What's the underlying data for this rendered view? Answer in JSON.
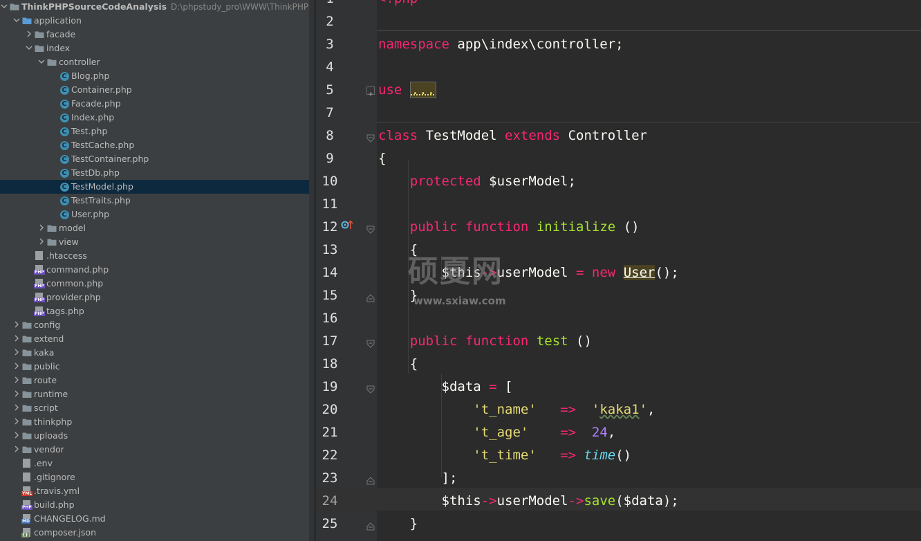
{
  "project": {
    "name": "ThinkPHPSourceCodeAnalysis",
    "path": "D:\\phpstudy_pro\\WWW\\ThinkPHPSource"
  },
  "tree": [
    {
      "label": "ThinkPHPSourceCodeAnalysis",
      "type": "root",
      "depth": 0,
      "arrow": "down"
    },
    {
      "label": "application",
      "type": "folder",
      "depth": 1,
      "arrow": "down"
    },
    {
      "label": "facade",
      "type": "folder",
      "depth": 2,
      "arrow": "right"
    },
    {
      "label": "index",
      "type": "folder",
      "depth": 2,
      "arrow": "down"
    },
    {
      "label": "controller",
      "type": "folder",
      "depth": 3,
      "arrow": "down"
    },
    {
      "label": "Blog.php",
      "type": "class",
      "depth": 4
    },
    {
      "label": "Container.php",
      "type": "class",
      "depth": 4
    },
    {
      "label": "Facade.php",
      "type": "class",
      "depth": 4
    },
    {
      "label": "Index.php",
      "type": "class",
      "depth": 4
    },
    {
      "label": "Test.php",
      "type": "class",
      "depth": 4
    },
    {
      "label": "TestCache.php",
      "type": "class",
      "depth": 4
    },
    {
      "label": "TestContainer.php",
      "type": "class",
      "depth": 4
    },
    {
      "label": "TestDb.php",
      "type": "class",
      "depth": 4
    },
    {
      "label": "TestModel.php",
      "type": "class",
      "depth": 4,
      "selected": true
    },
    {
      "label": "TestTraits.php",
      "type": "class",
      "depth": 4
    },
    {
      "label": "User.php",
      "type": "class",
      "depth": 4
    },
    {
      "label": "model",
      "type": "folder",
      "depth": 3,
      "arrow": "right"
    },
    {
      "label": "view",
      "type": "folder",
      "depth": 3,
      "arrow": "right"
    },
    {
      "label": ".htaccess",
      "type": "htaccess",
      "depth": 2
    },
    {
      "label": "command.php",
      "type": "php",
      "depth": 2
    },
    {
      "label": "common.php",
      "type": "php",
      "depth": 2
    },
    {
      "label": "provider.php",
      "type": "php",
      "depth": 2
    },
    {
      "label": "tags.php",
      "type": "php",
      "depth": 2
    },
    {
      "label": "config",
      "type": "folder",
      "depth": 1,
      "arrow": "right"
    },
    {
      "label": "extend",
      "type": "folder",
      "depth": 1,
      "arrow": "right"
    },
    {
      "label": "kaka",
      "type": "folder",
      "depth": 1,
      "arrow": "right"
    },
    {
      "label": "public",
      "type": "folder",
      "depth": 1,
      "arrow": "right"
    },
    {
      "label": "route",
      "type": "folder",
      "depth": 1,
      "arrow": "right"
    },
    {
      "label": "runtime",
      "type": "folder",
      "depth": 1,
      "arrow": "right"
    },
    {
      "label": "script",
      "type": "folder",
      "depth": 1,
      "arrow": "right"
    },
    {
      "label": "thinkphp",
      "type": "folder",
      "depth": 1,
      "arrow": "right"
    },
    {
      "label": "uploads",
      "type": "folder",
      "depth": 1,
      "arrow": "right"
    },
    {
      "label": "vendor",
      "type": "folder",
      "depth": 1,
      "arrow": "right"
    },
    {
      "label": ".env",
      "type": "text",
      "depth": 1
    },
    {
      "label": ".gitignore",
      "type": "gitignore",
      "depth": 1
    },
    {
      "label": ".travis.yml",
      "type": "yml",
      "depth": 1
    },
    {
      "label": "build.php",
      "type": "php",
      "depth": 1
    },
    {
      "label": "CHANGELOG.md",
      "type": "md",
      "depth": 1
    },
    {
      "label": "composer.json",
      "type": "json",
      "depth": 1
    }
  ],
  "editor": {
    "current_line": 24,
    "lines": [
      {
        "n": 1,
        "tokens": [
          {
            "t": "<?php",
            "c": "k"
          }
        ]
      },
      {
        "n": 2,
        "tokens": []
      },
      {
        "n": 3,
        "tokens": [
          {
            "t": "namespace",
            "c": "k"
          },
          {
            "t": " app\\index\\controller;"
          }
        ]
      },
      {
        "n": 4,
        "tokens": []
      },
      {
        "n": 5,
        "tokens": [
          {
            "t": "use",
            "c": "k"
          },
          {
            "t": " "
          },
          {
            "t": "...",
            "c": "folded"
          }
        ]
      },
      {
        "n": 7,
        "tokens": []
      },
      {
        "n": 8,
        "tokens": [
          {
            "t": "class",
            "c": "k"
          },
          {
            "t": " TestModel "
          },
          {
            "t": "extends",
            "c": "k"
          },
          {
            "t": " Controller"
          }
        ]
      },
      {
        "n": 9,
        "tokens": [
          {
            "t": "{"
          }
        ]
      },
      {
        "n": 10,
        "tokens": [
          {
            "t": "    "
          },
          {
            "t": "protected",
            "c": "k"
          },
          {
            "t": " $userModel;"
          }
        ]
      },
      {
        "n": 11,
        "tokens": []
      },
      {
        "n": 12,
        "tokens": [
          {
            "t": "    "
          },
          {
            "t": "public",
            "c": "k"
          },
          {
            "t": " "
          },
          {
            "t": "function",
            "c": "k"
          },
          {
            "t": " "
          },
          {
            "t": "initialize",
            "c": "fn"
          },
          {
            "t": " ()"
          }
        ]
      },
      {
        "n": 13,
        "tokens": [
          {
            "t": "    {"
          }
        ]
      },
      {
        "n": 14,
        "tokens": [
          {
            "t": "        $this"
          },
          {
            "t": "->",
            "c": "k"
          },
          {
            "t": "userModel "
          },
          {
            "t": "=",
            "c": "k"
          },
          {
            "t": " "
          },
          {
            "t": "new",
            "c": "k"
          },
          {
            "t": " "
          },
          {
            "t": "User",
            "c": "hl"
          },
          {
            "t": "();"
          }
        ]
      },
      {
        "n": 15,
        "tokens": [
          {
            "t": "    }"
          }
        ]
      },
      {
        "n": 16,
        "tokens": []
      },
      {
        "n": 17,
        "tokens": [
          {
            "t": "    "
          },
          {
            "t": "public",
            "c": "k"
          },
          {
            "t": " "
          },
          {
            "t": "function",
            "c": "k"
          },
          {
            "t": " "
          },
          {
            "t": "test",
            "c": "fn"
          },
          {
            "t": " ()"
          }
        ]
      },
      {
        "n": 18,
        "tokens": [
          {
            "t": "    {"
          }
        ]
      },
      {
        "n": 19,
        "tokens": [
          {
            "t": "        $data "
          },
          {
            "t": "=",
            "c": "k"
          },
          {
            "t": " ["
          }
        ]
      },
      {
        "n": 20,
        "tokens": [
          {
            "t": "            "
          },
          {
            "t": "'t_name'",
            "c": "str"
          },
          {
            "t": "   "
          },
          {
            "t": "=>",
            "c": "k"
          },
          {
            "t": "  "
          },
          {
            "t": "'kaka1'",
            "c": "str"
          },
          {
            "t": ","
          }
        ]
      },
      {
        "n": 21,
        "tokens": [
          {
            "t": "            "
          },
          {
            "t": "'t_age'",
            "c": "str"
          },
          {
            "t": "    "
          },
          {
            "t": "=>",
            "c": "k"
          },
          {
            "t": "  "
          },
          {
            "t": "24",
            "c": "num"
          },
          {
            "t": ","
          }
        ]
      },
      {
        "n": 22,
        "tokens": [
          {
            "t": "            "
          },
          {
            "t": "'t_time'",
            "c": "str"
          },
          {
            "t": "   "
          },
          {
            "t": "=>",
            "c": "k"
          },
          {
            "t": " "
          },
          {
            "t": "time",
            "c": "it"
          },
          {
            "t": "()"
          }
        ]
      },
      {
        "n": 23,
        "tokens": [
          {
            "t": "        ];"
          }
        ]
      },
      {
        "n": 24,
        "tokens": [
          {
            "t": "        $this"
          },
          {
            "t": "->",
            "c": "k"
          },
          {
            "t": "userModel"
          },
          {
            "t": "->",
            "c": "k"
          },
          {
            "t": "save",
            "c": "fn"
          },
          {
            "t": "($data);"
          }
        ]
      },
      {
        "n": 25,
        "tokens": [
          {
            "t": "    }"
          }
        ]
      }
    ]
  },
  "watermark": {
    "title": "硕夏网",
    "url": "www.sxiaw.com"
  },
  "colors": {
    "tree_bg": "#3c3f41",
    "selection": "#0d293e",
    "editor_bg": "#2b2b2b",
    "keyword": "#f92672",
    "function": "#a6e22e",
    "string": "#e6db74",
    "number": "#ae81ff"
  }
}
